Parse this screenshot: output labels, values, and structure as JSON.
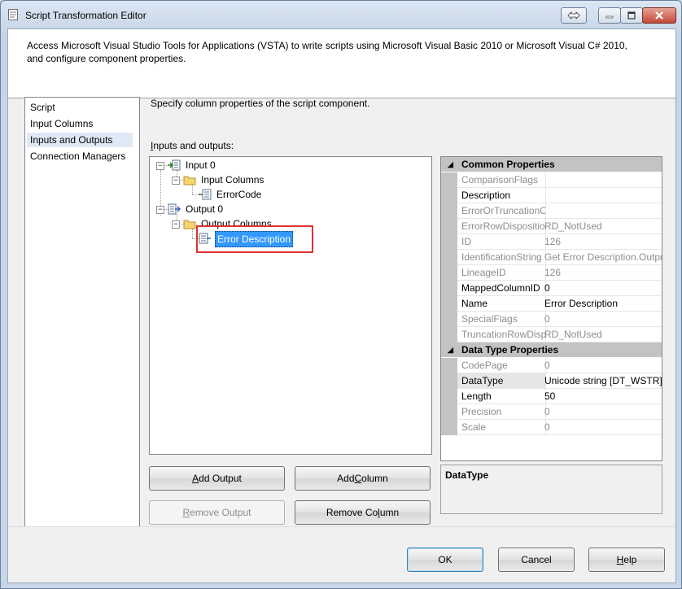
{
  "window": {
    "title": "Script Transformation Editor",
    "accent": "#c6d5e7",
    "close_color": "#c4473a"
  },
  "description": "Access Microsoft Visual Studio Tools for Applications (VSTA) to write scripts using Microsoft Visual Basic 2010 or Microsoft Visual C# 2010, and configure component properties.",
  "nav": {
    "items": [
      {
        "label": "Script"
      },
      {
        "label": "Input Columns"
      },
      {
        "label": "Inputs and Outputs",
        "selected": true
      },
      {
        "label": "Connection Managers"
      }
    ]
  },
  "page": {
    "description": "Specify column properties of the script component.",
    "io_label": "Inputs and outputs:",
    "io_label_underline": "I",
    "io_label_rest": "nputs and outputs:"
  },
  "tree": {
    "input0": "Input 0",
    "input_columns": "Input Columns",
    "error_code": "ErrorCode",
    "output0": "Output 0",
    "output_columns": "Output Columns",
    "error_description": "Error Description"
  },
  "buttons": {
    "add_output": {
      "pre": "",
      "u": "A",
      "post": "dd Output"
    },
    "add_column": {
      "pre": "Add ",
      "u": "C",
      "post": "olumn"
    },
    "remove_output": {
      "pre": "",
      "u": "R",
      "post": "emove Output"
    },
    "remove_column": {
      "pre": "Remove Co",
      "u": "l",
      "post": "umn"
    },
    "ok": "OK",
    "cancel": "Cancel",
    "help": {
      "pre": "",
      "u": "H",
      "post": "elp"
    }
  },
  "properties": {
    "common_header": "Common Properties",
    "common": [
      {
        "name": "ComparisonFlags",
        "value": "",
        "readonly": true
      },
      {
        "name": "Description",
        "value": "",
        "readonly": false
      },
      {
        "name": "ErrorOrTruncationOperation",
        "value": "",
        "readonly": true
      },
      {
        "name": "ErrorRowDisposition",
        "value": "RD_NotUsed",
        "readonly": true
      },
      {
        "name": "ID",
        "value": "126",
        "readonly": true
      },
      {
        "name": "IdentificationString",
        "value": "Get Error Description.Outputs",
        "readonly": true
      },
      {
        "name": "LineageID",
        "value": "126",
        "readonly": true
      },
      {
        "name": "MappedColumnID",
        "value": "0",
        "readonly": false
      },
      {
        "name": "Name",
        "value": "Error Description",
        "readonly": false
      },
      {
        "name": "SpecialFlags",
        "value": "0",
        "readonly": true
      },
      {
        "name": "TruncationRowDisposition",
        "value": "RD_NotUsed",
        "readonly": true
      }
    ],
    "datatype_header": "Data Type Properties",
    "datatype": [
      {
        "name": "CodePage",
        "value": "0",
        "readonly": true
      },
      {
        "name": "DataType",
        "value": "Unicode string [DT_WSTR]",
        "readonly": false,
        "selected": true
      },
      {
        "name": "Length",
        "value": "50",
        "readonly": false
      },
      {
        "name": "Precision",
        "value": "0",
        "readonly": true
      },
      {
        "name": "Scale",
        "value": "0",
        "readonly": true
      }
    ]
  },
  "help_panel": {
    "title": "DataType"
  }
}
